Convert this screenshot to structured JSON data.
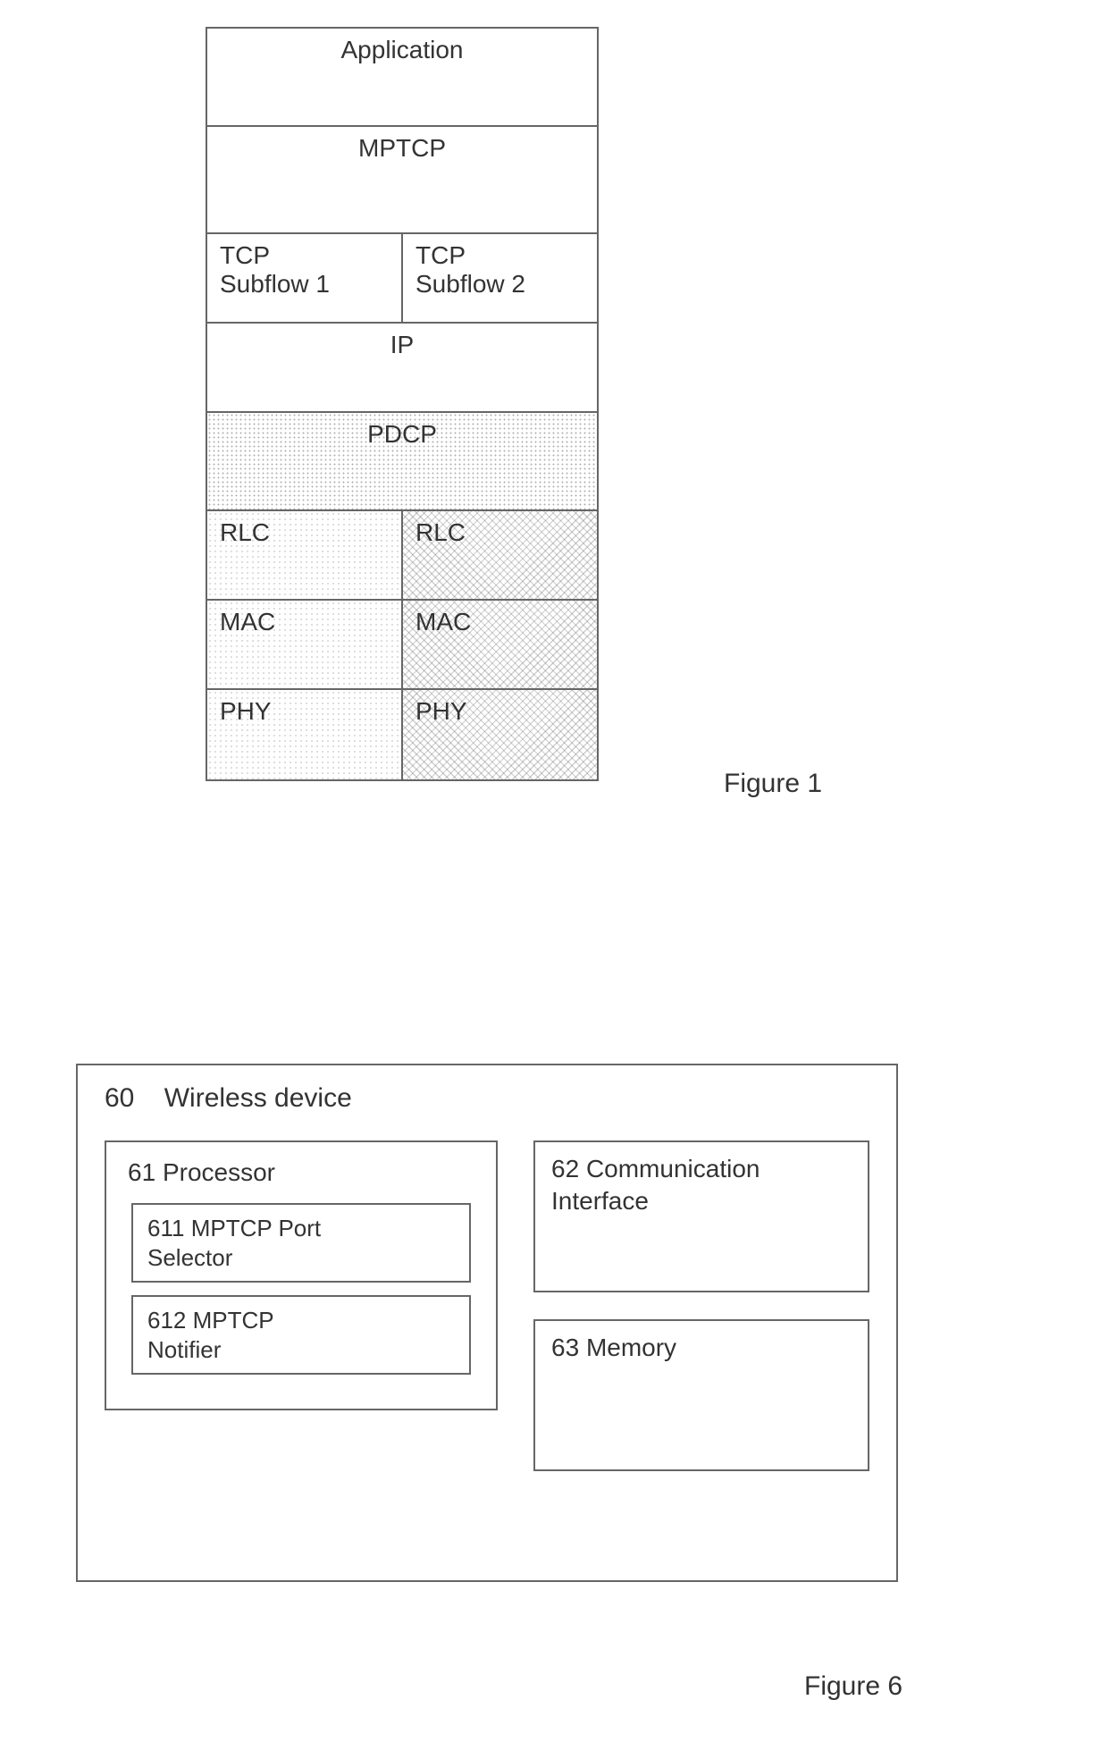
{
  "figure1": {
    "caption": "Figure 1",
    "layers": {
      "application": "Application",
      "mptcp": "MPTCP",
      "subflow1": "TCP\nSubflow 1",
      "subflow2": "TCP\nSubflow 2",
      "ip": "IP",
      "pdcp": "PDCP",
      "rlc_left": "RLC",
      "rlc_right": "RLC",
      "mac_left": "MAC",
      "mac_right": "MAC",
      "phy_left": "PHY",
      "phy_right": "PHY"
    }
  },
  "figure6": {
    "caption": "Figure 6",
    "device": {
      "ref": "60",
      "label": "Wireless device"
    },
    "processor": {
      "ref": "61",
      "label": "Processor",
      "port_selector": {
        "ref": "611",
        "label": "MPTCP Port\nSelector"
      },
      "notifier": {
        "ref": "612",
        "label": "MPTCP\nNotifier"
      }
    },
    "comm_interface": {
      "ref": "62",
      "label": "Communication\nInterface"
    },
    "memory": {
      "ref": "63",
      "label": "Memory"
    }
  },
  "chart_data": [
    {
      "type": "table",
      "title": "Figure 1: Protocol stack diagram (MPTCP over dual-connectivity radio)",
      "rows": [
        {
          "layer": "Application",
          "columns": [
            "Application"
          ]
        },
        {
          "layer": "MPTCP",
          "columns": [
            "MPTCP"
          ]
        },
        {
          "layer": "TCP subflows",
          "columns": [
            "TCP Subflow 1",
            "TCP Subflow 2"
          ]
        },
        {
          "layer": "IP",
          "columns": [
            "IP"
          ]
        },
        {
          "layer": "PDCP",
          "columns": [
            "PDCP"
          ]
        },
        {
          "layer": "RLC",
          "columns": [
            "RLC",
            "RLC"
          ]
        },
        {
          "layer": "MAC",
          "columns": [
            "MAC",
            "MAC"
          ]
        },
        {
          "layer": "PHY",
          "columns": [
            "PHY",
            "PHY"
          ]
        }
      ]
    },
    {
      "type": "table",
      "title": "Figure 6: Wireless device block diagram",
      "rows": [
        {
          "ref": "60",
          "block": "Wireless device",
          "contains": [
            "61",
            "62",
            "63"
          ]
        },
        {
          "ref": "61",
          "block": "Processor",
          "contains": [
            "611",
            "612"
          ]
        },
        {
          "ref": "611",
          "block": "MPTCP Port Selector"
        },
        {
          "ref": "612",
          "block": "MPTCP Notifier"
        },
        {
          "ref": "62",
          "block": "Communication Interface"
        },
        {
          "ref": "63",
          "block": "Memory"
        }
      ]
    }
  ]
}
